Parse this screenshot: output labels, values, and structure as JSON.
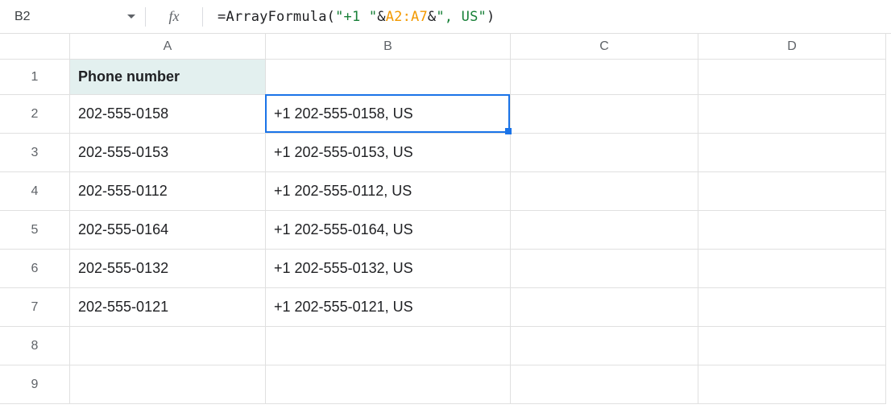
{
  "name_box": {
    "cell_ref": "B2"
  },
  "formula_bar": {
    "fx_label": "fx",
    "tokens": [
      {
        "text": "=",
        "cls": "tok-black"
      },
      {
        "text": "ArrayFormula",
        "cls": "tok-fn"
      },
      {
        "text": "(",
        "cls": "tok-black"
      },
      {
        "text": "\"+1 \"",
        "cls": "tok-str"
      },
      {
        "text": "&",
        "cls": "tok-op"
      },
      {
        "text": "A2:A7",
        "cls": "tok-ref"
      },
      {
        "text": "&",
        "cls": "tok-op"
      },
      {
        "text": "\", US\"",
        "cls": "tok-str"
      },
      {
        "text": ")",
        "cls": "tok-black"
      }
    ]
  },
  "columns": [
    "A",
    "B",
    "C",
    "D"
  ],
  "rows": [
    "1",
    "2",
    "3",
    "4",
    "5",
    "6",
    "7",
    "8",
    "9"
  ],
  "selected": {
    "row": "2",
    "col": "B"
  },
  "cells": {
    "A1": "Phone number",
    "A2": "202-555-0158",
    "A3": "202-555-0153",
    "A4": "202-555-0112",
    "A5": "202-555-0164",
    "A6": "202-555-0132",
    "A7": "202-555-0121",
    "B2": "+1 202-555-0158, US",
    "B3": "+1 202-555-0153, US",
    "B4": "+1 202-555-0112, US",
    "B5": "+1 202-555-0164, US",
    "B6": "+1 202-555-0132, US",
    "B7": "+1 202-555-0121, US"
  },
  "chart_data": {
    "type": "table",
    "columns": [
      "Phone number",
      ""
    ],
    "rows": [
      [
        "202-555-0158",
        "+1 202-555-0158, US"
      ],
      [
        "202-555-0153",
        "+1 202-555-0153, US"
      ],
      [
        "202-555-0112",
        "+1 202-555-0112, US"
      ],
      [
        "202-555-0164",
        "+1 202-555-0164, US"
      ],
      [
        "202-555-0132",
        "+1 202-555-0132, US"
      ],
      [
        "202-555-0121",
        "+1 202-555-0121, US"
      ]
    ]
  }
}
